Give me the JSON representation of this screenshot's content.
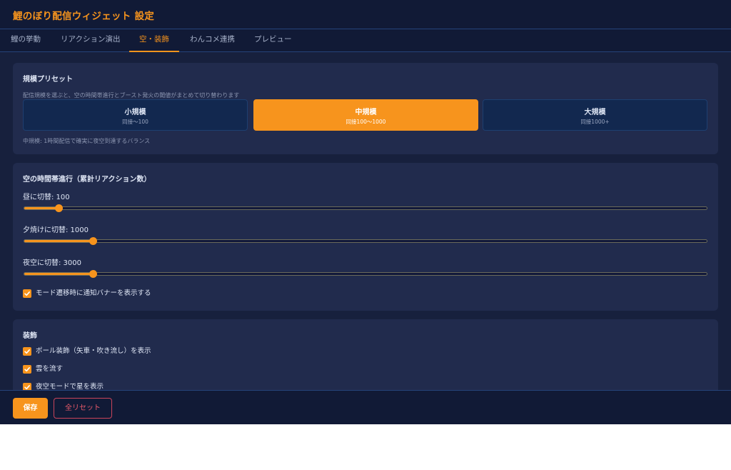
{
  "window": {
    "title": "鯉のぼり配信ウィジェット 設定"
  },
  "tabs": [
    {
      "label": "鯉の挙動"
    },
    {
      "label": "リアクション演出"
    },
    {
      "label": "空・装飾"
    },
    {
      "label": "わんコメ連携"
    },
    {
      "label": "プレビュー"
    }
  ],
  "active_tab": "空・装飾",
  "preset_panel": {
    "title": "規模プリセット",
    "description": "配信規模を選ぶと、空の時間帯進行とブースト発火の閾値がまとめて切り替わります",
    "presets": [
      {
        "name": "小規模",
        "sub": "同接〜100"
      },
      {
        "name": "中規模",
        "sub": "同接100〜1000"
      },
      {
        "name": "大規模",
        "sub": "同接1000+"
      }
    ],
    "selected": "中規模",
    "note": "中規模: 1時間配信で確実に夜空到達するバランス"
  },
  "sky_panel": {
    "title": "空の時間帯進行（累計リアクション数）",
    "sliders": [
      {
        "label": "昼に切替: 100",
        "level": 0.05
      },
      {
        "label": "夕焼けに切替: 1000",
        "level": 0.1
      },
      {
        "label": "夜空に切替: 3000",
        "level": 0.1
      }
    ],
    "checkbox": {
      "label": "モード遷移時に通知バナーを表示する",
      "checked": true
    }
  },
  "decoration_panel": {
    "title": "装飾",
    "checkboxes": [
      {
        "label": "ポール装飾（矢車・吹き流し）を表示",
        "checked": true
      },
      {
        "label": "雲を流す",
        "checked": true
      },
      {
        "label": "夜空モードで星を表示",
        "checked": true
      }
    ]
  },
  "footer": {
    "save_label": "保存",
    "reset_label": "全リセット"
  },
  "colors": {
    "accent": "#f7941d",
    "background": "#17203d",
    "panel": "#212b4d",
    "danger": "#e85a6a"
  }
}
